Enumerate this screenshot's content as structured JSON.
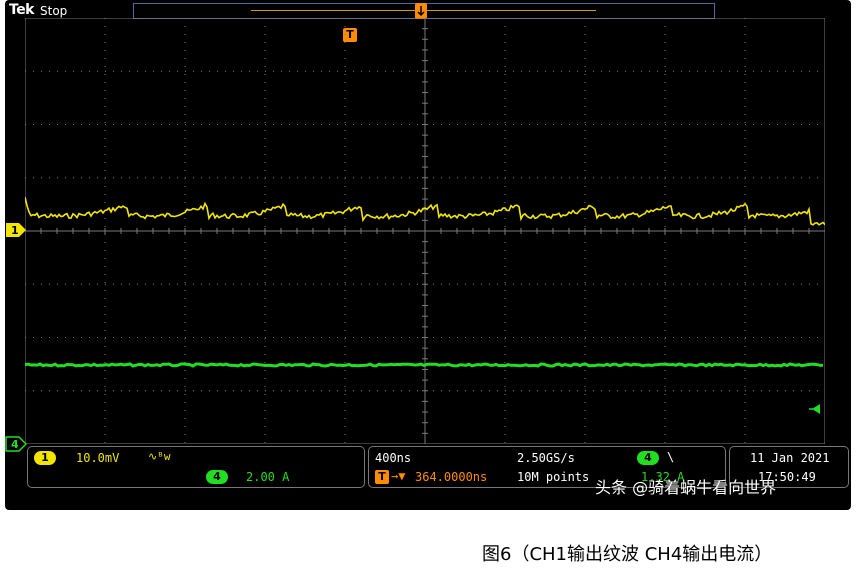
{
  "header": {
    "brand": "Tek",
    "run_state": "Stop"
  },
  "trigger_marker": "T",
  "channels": {
    "ch1": {
      "id": "1",
      "scale": "10.0mV",
      "coupling_icon": "∿ᴮw",
      "color": "#f2e600"
    },
    "ch4": {
      "id": "4",
      "scale": "2.00 A",
      "color": "#22dd22"
    }
  },
  "horizontal": {
    "timebase": "400ns",
    "sample_rate": "2.50GS/s",
    "delay": "364.0000ns",
    "record_length": "10M points"
  },
  "trigger": {
    "source": "4",
    "slope": "\\",
    "level": "1.32 A"
  },
  "datetime": {
    "date": "11 Jan 2021",
    "time": "17:50:49"
  },
  "watermark": "头条 @骑着蜗牛看向世界",
  "caption": "图6（CH1输出纹波 CH4输出电流）",
  "colors": {
    "grid": "#7a7a7a",
    "trigger_orange": "#ff8c00",
    "panel_border": "#777777"
  }
}
